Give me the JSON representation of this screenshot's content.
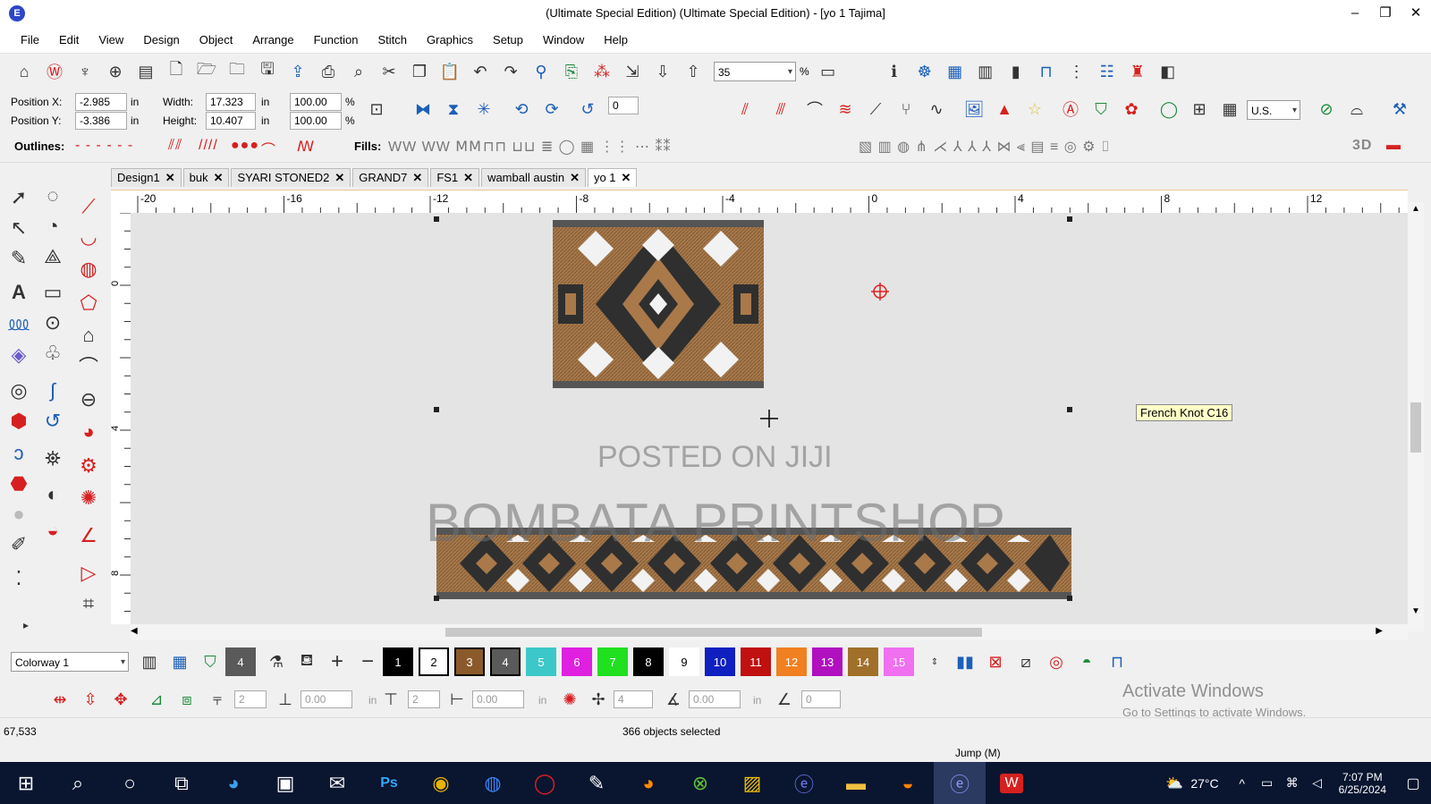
{
  "titlebar": {
    "title": "(Ultimate Special Edition) (Ultimate Special Edition) - [yo 1          Tajima]",
    "app_icon": "app-logo-icon",
    "controls": [
      "–",
      "❐",
      "✕"
    ]
  },
  "menubar": {
    "items": [
      "File",
      "Edit",
      "View",
      "Design",
      "Object",
      "Arrange",
      "Function",
      "Stitch",
      "Graphics",
      "Setup",
      "Window",
      "Help"
    ]
  },
  "toolbar1": {
    "zoom_value": "35",
    "zoom_unit": "%"
  },
  "toolbar2": {
    "position_x_label": "Position X:",
    "position_x_value": "-2.985",
    "position_y_label": "Position Y:",
    "position_y_value": "-3.386",
    "unit": "in",
    "width_label": "Width:",
    "width_value": "17.323",
    "height_label": "Height:",
    "height_value": "10.407",
    "scale_x": "100.00",
    "scale_y": "100.00",
    "percent": "%",
    "rotate_value": "0",
    "units_select": "U.S."
  },
  "toolbar3": {
    "outlines_label": "Outlines:",
    "fills_label": "Fills:",
    "three_d_label": "3D"
  },
  "tabs": [
    {
      "label": "Design1",
      "active": false
    },
    {
      "label": "buk",
      "active": false
    },
    {
      "label": "SYARI STONED2",
      "active": false
    },
    {
      "label": "GRAND7",
      "active": false
    },
    {
      "label": "FS1",
      "active": false
    },
    {
      "label": "wamball austin",
      "active": false
    },
    {
      "label": "yo 1",
      "active": true
    }
  ],
  "ruler": {
    "h_ticks": [
      "-20",
      "-16",
      "-12",
      "-8",
      "-4",
      "0",
      "4",
      "8",
      "12"
    ],
    "v_ticks": [
      "0",
      "4",
      "8"
    ]
  },
  "canvas": {
    "tooltip": "French Knot C16",
    "watermark_1": "POSTED ON JIJI",
    "watermark_2": "BOMBATA PRINTSHOP",
    "colors": {
      "brown": "#a9794a",
      "dark": "#2f2f2f",
      "white": "#f2f2f2",
      "accent_red": "#e02020"
    }
  },
  "colorway": {
    "select_value": "Colorway 1",
    "current_color_num": "4",
    "swatches": [
      {
        "num": "1",
        "bg": "#000000",
        "fg": "#ffffff",
        "selected": true
      },
      {
        "num": "2",
        "bg": "#ffffff",
        "fg": "#000000",
        "selected": true
      },
      {
        "num": "3",
        "bg": "#8b5a2b",
        "fg": "#ffffff",
        "selected": true
      },
      {
        "num": "4",
        "bg": "#5a5a5a",
        "fg": "#ffffff",
        "selected": true
      },
      {
        "num": "5",
        "bg": "#3cc8c8",
        "fg": "#ffffff",
        "selected": false
      },
      {
        "num": "6",
        "bg": "#e020e0",
        "fg": "#ffffff",
        "selected": false
      },
      {
        "num": "7",
        "bg": "#20e020",
        "fg": "#ffffff",
        "selected": false
      },
      {
        "num": "8",
        "bg": "#000000",
        "fg": "#ffffff",
        "selected": false
      },
      {
        "num": "9",
        "bg": "#ffffff",
        "fg": "#000000",
        "selected": false
      },
      {
        "num": "10",
        "bg": "#1020c0",
        "fg": "#ffffff",
        "selected": false
      },
      {
        "num": "11",
        "bg": "#c01010",
        "fg": "#ffffff",
        "selected": false
      },
      {
        "num": "12",
        "bg": "#f08020",
        "fg": "#ffffff",
        "selected": false
      },
      {
        "num": "13",
        "bg": "#b010c0",
        "fg": "#ffffff",
        "selected": false
      },
      {
        "num": "14",
        "bg": "#a0702a",
        "fg": "#ffffff",
        "selected": false
      },
      {
        "num": "15",
        "bg": "#f070f0",
        "fg": "#ffffff",
        "selected": false
      }
    ]
  },
  "bottombar2": {
    "val_a": "2",
    "val_b": "0.00",
    "val_c": "2",
    "val_d": "0.00",
    "val_e": "4",
    "val_f": "0.00",
    "val_g": "0",
    "in": "in"
  },
  "status": {
    "coords": "67,533",
    "selection": "366 objects selected",
    "mode": "Jump (M)",
    "activate_title": "Activate Windows",
    "activate_sub": "Go to Settings to activate Windows."
  },
  "taskbar": {
    "temperature": "27°C",
    "time": "7:07 PM",
    "date": "6/25/2024",
    "ps_label": "Ps"
  }
}
